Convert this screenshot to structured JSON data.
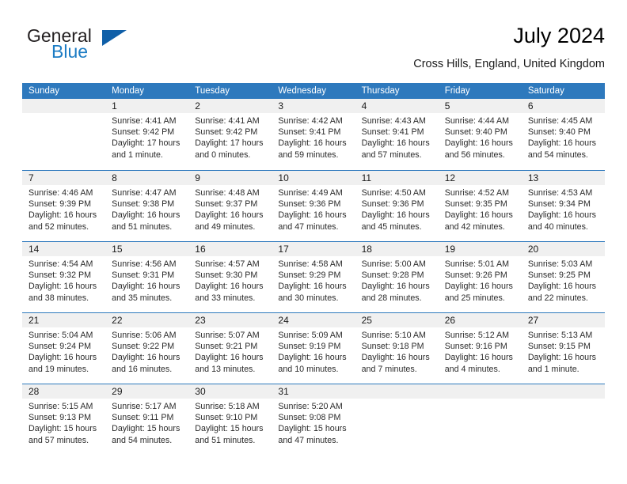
{
  "brand": {
    "word_general": "General",
    "word_blue": "Blue",
    "triangle_color": "#0f5fa8",
    "blue_color": "#1c7cc4"
  },
  "header": {
    "title": "July 2024",
    "location": "Cross Hills, England, United Kingdom"
  },
  "theme": {
    "header_blue": "#2e79bd",
    "daynum_band": "#f0f0f0",
    "text": "#2b2b2b"
  },
  "weekdays": [
    "Sunday",
    "Monday",
    "Tuesday",
    "Wednesday",
    "Thursday",
    "Friday",
    "Saturday"
  ],
  "weeks": [
    [
      {
        "day": "",
        "lines": []
      },
      {
        "day": "1",
        "lines": [
          "Sunrise: 4:41 AM",
          "Sunset: 9:42 PM",
          "Daylight: 17 hours",
          "and 1 minute."
        ]
      },
      {
        "day": "2",
        "lines": [
          "Sunrise: 4:41 AM",
          "Sunset: 9:42 PM",
          "Daylight: 17 hours",
          "and 0 minutes."
        ]
      },
      {
        "day": "3",
        "lines": [
          "Sunrise: 4:42 AM",
          "Sunset: 9:41 PM",
          "Daylight: 16 hours",
          "and 59 minutes."
        ]
      },
      {
        "day": "4",
        "lines": [
          "Sunrise: 4:43 AM",
          "Sunset: 9:41 PM",
          "Daylight: 16 hours",
          "and 57 minutes."
        ]
      },
      {
        "day": "5",
        "lines": [
          "Sunrise: 4:44 AM",
          "Sunset: 9:40 PM",
          "Daylight: 16 hours",
          "and 56 minutes."
        ]
      },
      {
        "day": "6",
        "lines": [
          "Sunrise: 4:45 AM",
          "Sunset: 9:40 PM",
          "Daylight: 16 hours",
          "and 54 minutes."
        ]
      }
    ],
    [
      {
        "day": "7",
        "lines": [
          "Sunrise: 4:46 AM",
          "Sunset: 9:39 PM",
          "Daylight: 16 hours",
          "and 52 minutes."
        ]
      },
      {
        "day": "8",
        "lines": [
          "Sunrise: 4:47 AM",
          "Sunset: 9:38 PM",
          "Daylight: 16 hours",
          "and 51 minutes."
        ]
      },
      {
        "day": "9",
        "lines": [
          "Sunrise: 4:48 AM",
          "Sunset: 9:37 PM",
          "Daylight: 16 hours",
          "and 49 minutes."
        ]
      },
      {
        "day": "10",
        "lines": [
          "Sunrise: 4:49 AM",
          "Sunset: 9:36 PM",
          "Daylight: 16 hours",
          "and 47 minutes."
        ]
      },
      {
        "day": "11",
        "lines": [
          "Sunrise: 4:50 AM",
          "Sunset: 9:36 PM",
          "Daylight: 16 hours",
          "and 45 minutes."
        ]
      },
      {
        "day": "12",
        "lines": [
          "Sunrise: 4:52 AM",
          "Sunset: 9:35 PM",
          "Daylight: 16 hours",
          "and 42 minutes."
        ]
      },
      {
        "day": "13",
        "lines": [
          "Sunrise: 4:53 AM",
          "Sunset: 9:34 PM",
          "Daylight: 16 hours",
          "and 40 minutes."
        ]
      }
    ],
    [
      {
        "day": "14",
        "lines": [
          "Sunrise: 4:54 AM",
          "Sunset: 9:32 PM",
          "Daylight: 16 hours",
          "and 38 minutes."
        ]
      },
      {
        "day": "15",
        "lines": [
          "Sunrise: 4:56 AM",
          "Sunset: 9:31 PM",
          "Daylight: 16 hours",
          "and 35 minutes."
        ]
      },
      {
        "day": "16",
        "lines": [
          "Sunrise: 4:57 AM",
          "Sunset: 9:30 PM",
          "Daylight: 16 hours",
          "and 33 minutes."
        ]
      },
      {
        "day": "17",
        "lines": [
          "Sunrise: 4:58 AM",
          "Sunset: 9:29 PM",
          "Daylight: 16 hours",
          "and 30 minutes."
        ]
      },
      {
        "day": "18",
        "lines": [
          "Sunrise: 5:00 AM",
          "Sunset: 9:28 PM",
          "Daylight: 16 hours",
          "and 28 minutes."
        ]
      },
      {
        "day": "19",
        "lines": [
          "Sunrise: 5:01 AM",
          "Sunset: 9:26 PM",
          "Daylight: 16 hours",
          "and 25 minutes."
        ]
      },
      {
        "day": "20",
        "lines": [
          "Sunrise: 5:03 AM",
          "Sunset: 9:25 PM",
          "Daylight: 16 hours",
          "and 22 minutes."
        ]
      }
    ],
    [
      {
        "day": "21",
        "lines": [
          "Sunrise: 5:04 AM",
          "Sunset: 9:24 PM",
          "Daylight: 16 hours",
          "and 19 minutes."
        ]
      },
      {
        "day": "22",
        "lines": [
          "Sunrise: 5:06 AM",
          "Sunset: 9:22 PM",
          "Daylight: 16 hours",
          "and 16 minutes."
        ]
      },
      {
        "day": "23",
        "lines": [
          "Sunrise: 5:07 AM",
          "Sunset: 9:21 PM",
          "Daylight: 16 hours",
          "and 13 minutes."
        ]
      },
      {
        "day": "24",
        "lines": [
          "Sunrise: 5:09 AM",
          "Sunset: 9:19 PM",
          "Daylight: 16 hours",
          "and 10 minutes."
        ]
      },
      {
        "day": "25",
        "lines": [
          "Sunrise: 5:10 AM",
          "Sunset: 9:18 PM",
          "Daylight: 16 hours",
          "and 7 minutes."
        ]
      },
      {
        "day": "26",
        "lines": [
          "Sunrise: 5:12 AM",
          "Sunset: 9:16 PM",
          "Daylight: 16 hours",
          "and 4 minutes."
        ]
      },
      {
        "day": "27",
        "lines": [
          "Sunrise: 5:13 AM",
          "Sunset: 9:15 PM",
          "Daylight: 16 hours",
          "and 1 minute."
        ]
      }
    ],
    [
      {
        "day": "28",
        "lines": [
          "Sunrise: 5:15 AM",
          "Sunset: 9:13 PM",
          "Daylight: 15 hours",
          "and 57 minutes."
        ]
      },
      {
        "day": "29",
        "lines": [
          "Sunrise: 5:17 AM",
          "Sunset: 9:11 PM",
          "Daylight: 15 hours",
          "and 54 minutes."
        ]
      },
      {
        "day": "30",
        "lines": [
          "Sunrise: 5:18 AM",
          "Sunset: 9:10 PM",
          "Daylight: 15 hours",
          "and 51 minutes."
        ]
      },
      {
        "day": "31",
        "lines": [
          "Sunrise: 5:20 AM",
          "Sunset: 9:08 PM",
          "Daylight: 15 hours",
          "and 47 minutes."
        ]
      },
      {
        "day": "",
        "lines": []
      },
      {
        "day": "",
        "lines": []
      },
      {
        "day": "",
        "lines": []
      }
    ]
  ]
}
